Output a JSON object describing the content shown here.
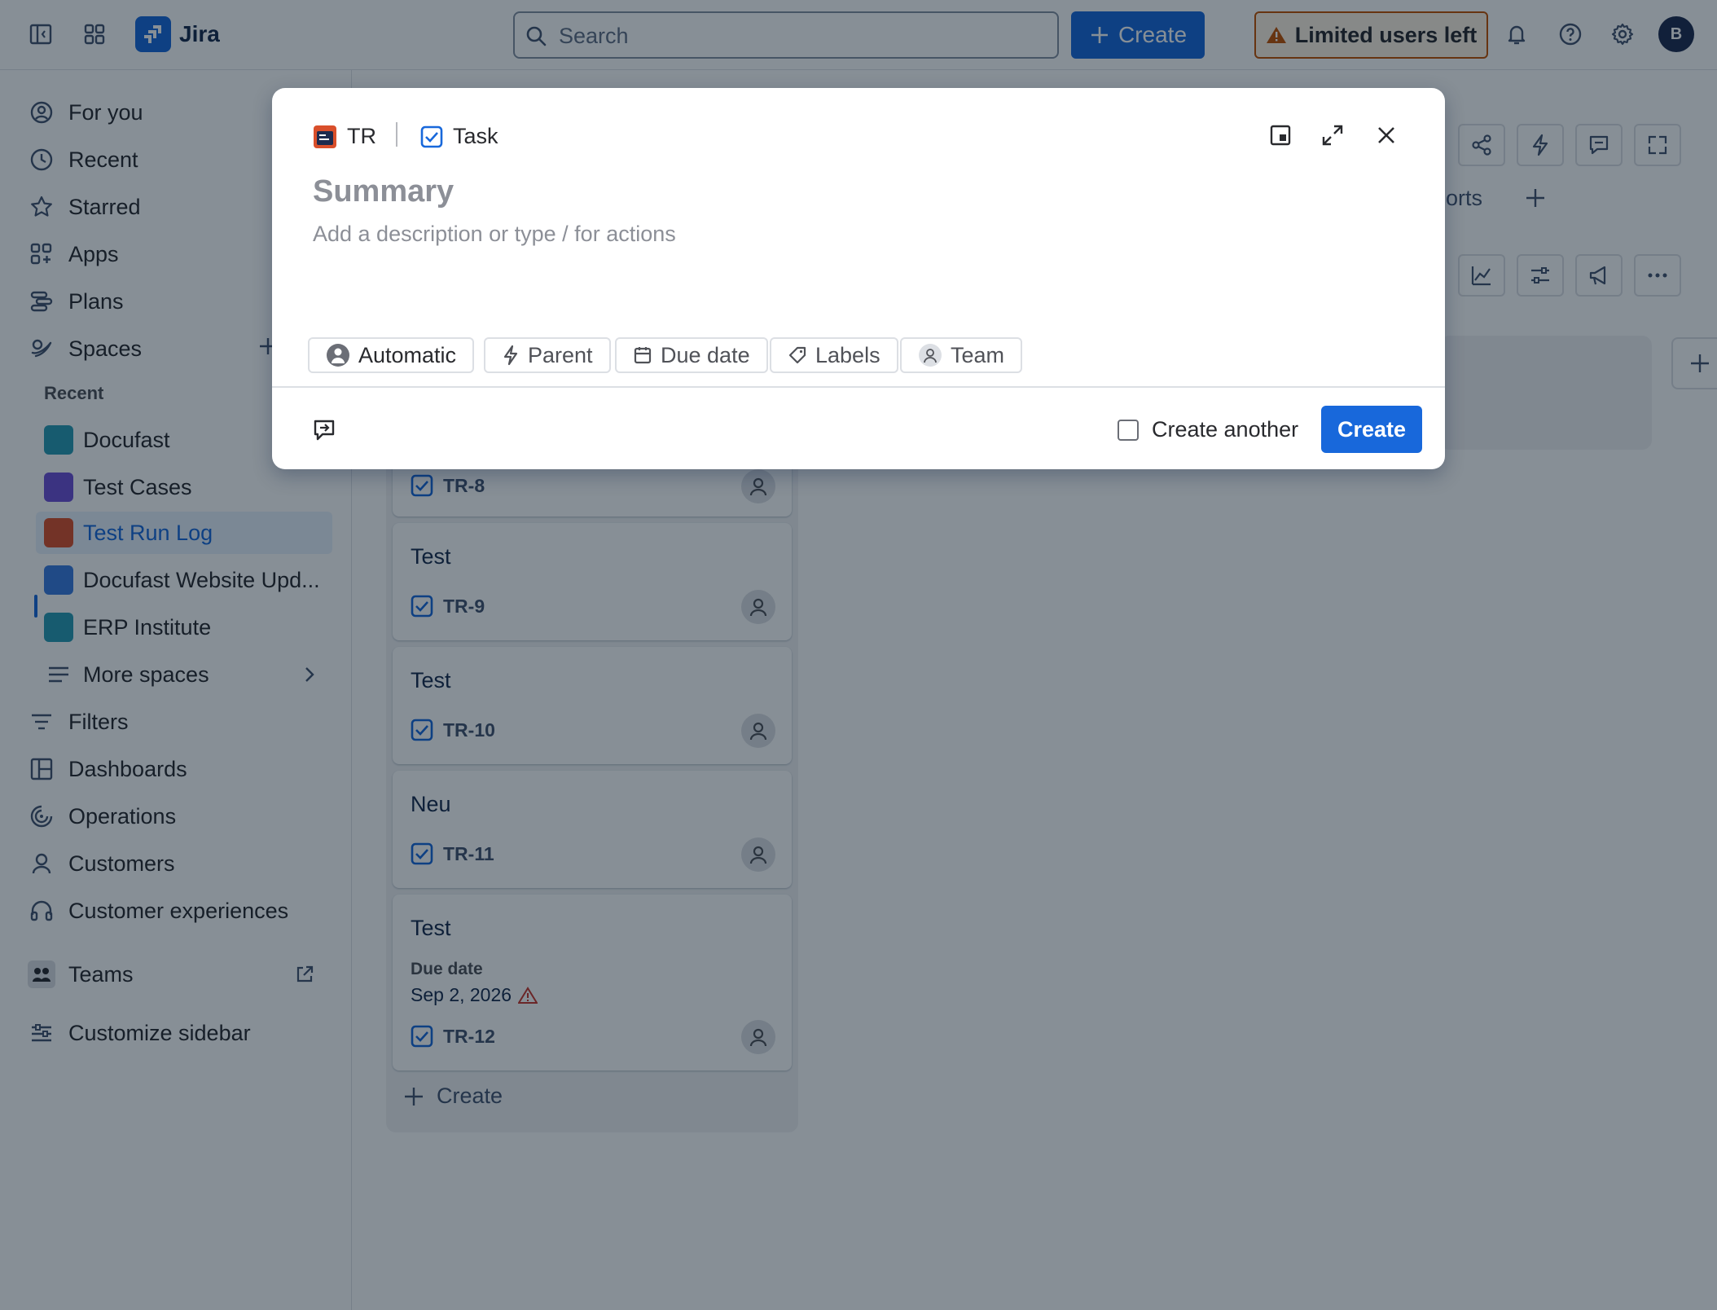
{
  "topbar": {
    "app_name": "Jira",
    "search_placeholder": "Search",
    "create_label": "Create",
    "limited_label": "Limited users left",
    "avatar_initial": "B"
  },
  "sidebar": {
    "items": [
      {
        "label": "For you",
        "icon": "for-you-icon"
      },
      {
        "label": "Recent",
        "icon": "clock-icon"
      },
      {
        "label": "Starred",
        "icon": "star-icon"
      },
      {
        "label": "Apps",
        "icon": "apps-icon"
      },
      {
        "label": "Plans",
        "icon": "plans-icon"
      },
      {
        "label": "Spaces",
        "icon": "spaces-icon"
      }
    ],
    "recent_label": "Recent",
    "spaces": [
      {
        "label": "Docufast",
        "color": "#2a9bb5"
      },
      {
        "label": "Test Cases",
        "color": "#6e4fd6"
      },
      {
        "label": "Test Run Log",
        "color": "#d94f2b"
      },
      {
        "label": "Docufast Website Upd...",
        "color": "#3a7be0"
      },
      {
        "label": "ERP Institute",
        "color": "#2a9bb5"
      }
    ],
    "more_spaces": "More spaces",
    "items2": [
      {
        "label": "Filters"
      },
      {
        "label": "Dashboards"
      },
      {
        "label": "Operations"
      },
      {
        "label": "Customers"
      },
      {
        "label": "Customer experiences"
      }
    ],
    "teams": "Teams",
    "customize": "Customize sidebar"
  },
  "board": {
    "tab_partial": "ports",
    "cards": [
      {
        "title": "",
        "key": "TR-8"
      },
      {
        "title": "Test",
        "key": "TR-9"
      },
      {
        "title": "Test",
        "key": "TR-10"
      },
      {
        "title": "Neu",
        "key": "TR-11"
      },
      {
        "title": "Test",
        "key": "TR-12",
        "due_label": "Due date",
        "due_value": "Sep 2, 2026"
      }
    ],
    "create_label": "Create"
  },
  "modal": {
    "project_key": "TR",
    "issue_type": "Task",
    "summary_placeholder": "Summary",
    "description_placeholder": "Add a description or type / for actions",
    "chips": {
      "assignee": "Automatic",
      "parent": "Parent",
      "due_date": "Due date",
      "labels": "Labels",
      "team": "Team"
    },
    "create_another": "Create another",
    "create_button": "Create"
  },
  "colors": {
    "primary": "#1868db",
    "warning": "#c25100",
    "overlay": "rgba(5,21,36,0.48)"
  }
}
